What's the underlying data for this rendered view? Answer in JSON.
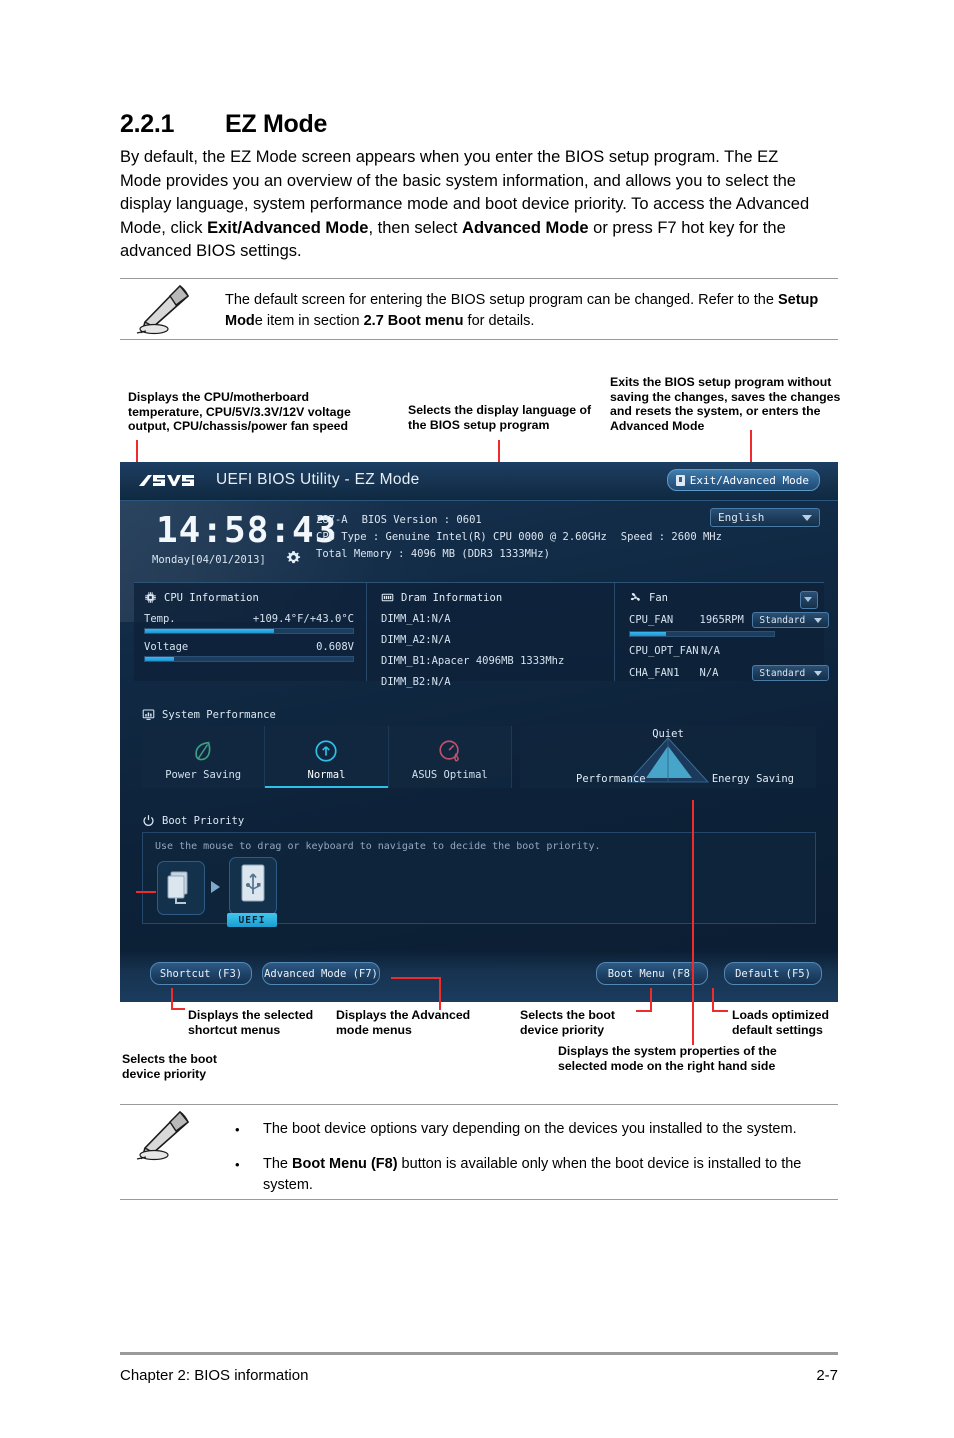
{
  "section": {
    "number": "2.2.1",
    "title": "EZ Mode",
    "intro": "By default, the EZ Mode screen appears when you enter the BIOS setup program. The EZ Mode provides you an overview of the basic system information, and allows you to select the display language, system performance mode and boot device priority. To access the Advanced Mode, click Exit/Advanced Mode, then select Advanced Mode or press F7 hot key for the advanced BIOS settings."
  },
  "note_top": {
    "icon": "pen-note-icon",
    "text_part1": "The default screen for entering the BIOS setup program can be changed. Refer to the ",
    "bold1": "Setup Mod",
    "text_part2": "e item in section ",
    "bold2": "2.7 Boot menu",
    "text_part3": " for details."
  },
  "callouts_top": [
    {
      "name": "callout-sensors",
      "text": "Displays the CPU/motherboard temperature, CPU/5V/3.3V/12V voltage output,  CPU/chassis/power fan speed"
    },
    {
      "name": "callout-language",
      "text": "Selects the display language of the BIOS setup program"
    },
    {
      "name": "callout-exit",
      "text": "Exits the BIOS setup program without saving the changes, saves the changes and resets the system, or enters the Advanced Mode"
    }
  ],
  "callouts_bottom": [
    {
      "name": "callout-shortcut",
      "text": "Displays the selected shortcut menus"
    },
    {
      "name": "callout-advanced",
      "text": "Displays the Advanced mode menus"
    },
    {
      "name": "callout-boot-menu",
      "text": "Selects the boot device priority"
    },
    {
      "name": "callout-default",
      "text": "Loads optimized default settings"
    },
    {
      "name": "callout-sysprops",
      "text": "Displays the system properties of the selected mode on the right hand side"
    },
    {
      "name": "callout-boot-priority",
      "text": "Selects the boot device priority"
    }
  ],
  "bios": {
    "brand": "ASUS",
    "title": "UEFI BIOS Utility - EZ Mode",
    "exit_button": "Exit/Advanced Mode",
    "language": "English",
    "clock": "14:58:43",
    "date": "Monday[04/01/2013]",
    "sysinfo": {
      "board": "Z87-A",
      "bios_version": "BIOS Version : 0601",
      "cpu_type": "CPU Type : Genuine Intel(R) CPU 0000 @ 2.60GHz",
      "speed": "Speed : 2600 MHz",
      "memory": "Total Memory : 4096 MB (DDR3 1333MHz)"
    },
    "cpu_panel": {
      "title": "CPU Information",
      "temp_label": "Temp.",
      "temp_value": "+109.4°F/+43.0°C",
      "temp_pct": 62,
      "voltage_label": "Voltage",
      "voltage_value": "0.608V",
      "voltage_pct": 14
    },
    "dram_panel": {
      "title": "Dram Information",
      "slots": [
        "DIMM_A1:N/A",
        "DIMM_A2:N/A",
        "DIMM_B1:Apacer 4096MB 1333Mhz",
        "DIMM_B2:N/A"
      ]
    },
    "fan_panel": {
      "title": "Fan",
      "rows": [
        {
          "name": "CPU_FAN",
          "value": "1965RPM",
          "profile": "Standard",
          "bar_pct": 25
        },
        {
          "name": "CPU_OPT_FAN",
          "value": "N/A",
          "profile": "",
          "bar_pct": 0
        },
        {
          "name": "CHA_FAN1",
          "value": "N/A",
          "profile": "Standard",
          "bar_pct": 0
        }
      ]
    },
    "performance": {
      "label": "System Performance",
      "tiles": [
        {
          "label": "Power Saving",
          "icon": "leaf-icon",
          "active": false
        },
        {
          "label": "Normal",
          "icon": "gauge-up-icon",
          "active": true
        },
        {
          "label": "ASUS Optimal",
          "icon": "speedometer-icon",
          "active": false
        }
      ],
      "radar": {
        "top": "Quiet",
        "left": "Performance",
        "right": "Energy Saving"
      }
    },
    "boot": {
      "label": "Boot Priority",
      "hint": "Use the mouse to drag or keyboard to navigate to decide the boot priority.",
      "devices": [
        {
          "icon": "hard-disk-icon",
          "tag": ""
        },
        {
          "icon": "usb-drive-icon",
          "tag": "UEFI"
        }
      ]
    },
    "bottom_buttons": {
      "shortcut": "Shortcut (F3)",
      "advanced": "Advanced Mode (F7)",
      "boot_menu": "Boot Menu (F8)",
      "default": "Default (F5)"
    }
  },
  "note_bottom": {
    "icon": "pen-note-icon",
    "bullet": "•",
    "items": [
      {
        "plain_pre": "The boot device options vary depending on the devices you installed to the system.",
        "bold": "",
        "plain_post": ""
      },
      {
        "plain_pre": "The ",
        "bold": "Boot Menu (F8)",
        "plain_post": " button is available only when the boot device is installed to the system."
      }
    ]
  },
  "footer": {
    "left": "Chapter 2: BIOS information",
    "right": "2-7"
  },
  "colors": {
    "callout_red": "#ef2b2b",
    "bios_accent": "#2fc0e8",
    "rule_gray": "#9a9a9a"
  }
}
